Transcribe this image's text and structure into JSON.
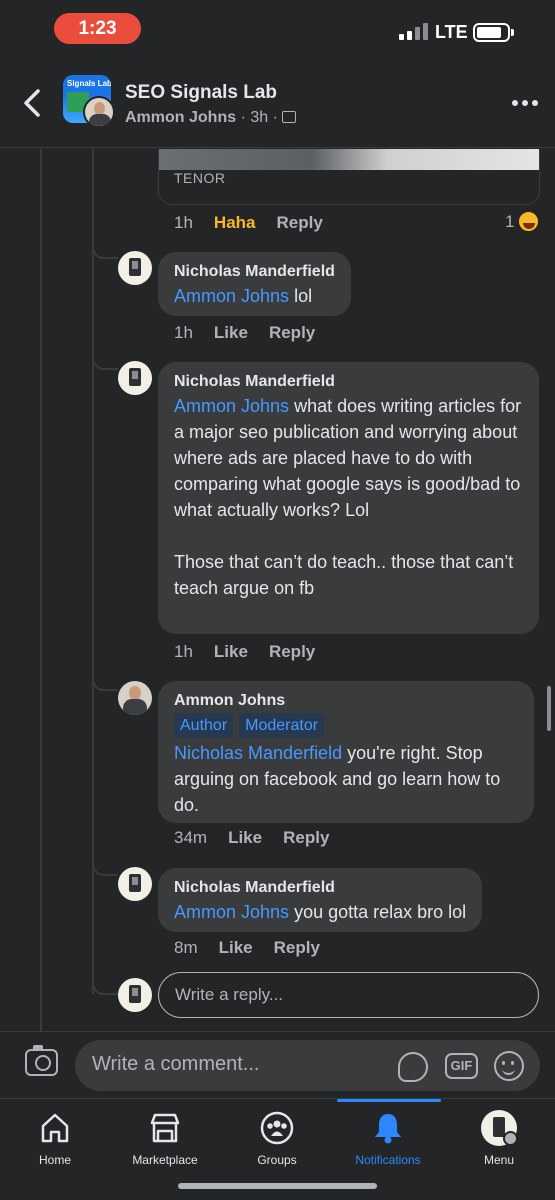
{
  "status_bar": {
    "time": "1:23",
    "network": "LTE"
  },
  "header": {
    "group_name": "SEO Signals Lab",
    "group_avatar_text": "Signals Lab",
    "author": "Ammon Johns",
    "time": "3h",
    "separator": "·"
  },
  "thread": {
    "gif_source": "TENOR",
    "gif_actions": {
      "time": "1h",
      "reaction": "Haha",
      "reply": "Reply",
      "reaction_count": "1"
    },
    "comments": [
      {
        "name": "Nicholas Manderfield",
        "mention": "Ammon Johns",
        "text": " lol",
        "time": "1h",
        "like": "Like",
        "reply": "Reply"
      },
      {
        "name": "Nicholas Manderfield",
        "mention": "Ammon Johns",
        "text": " what does writing articles for a major seo publication and worrying about where ads are placed have to do with comparing what google says is good/bad to what actually works? Lol",
        "text2": "Those that can’t do teach.. those that can’t teach argue on fb",
        "time": "1h",
        "like": "Like",
        "reply": "Reply"
      },
      {
        "name": "Ammon Johns",
        "badges": [
          "Author",
          "Moderator"
        ],
        "mention": "Nicholas Manderfield",
        "text": " you're right. Stop arguing on facebook and go learn how to do.",
        "time": "34m",
        "like": "Like",
        "reply": "Reply"
      },
      {
        "name": "Nicholas Manderfield",
        "mention": "Ammon Johns",
        "text": " you gotta relax bro lol",
        "time": "8m",
        "like": "Like",
        "reply": "Reply"
      }
    ],
    "reply_placeholder": "Write a reply..."
  },
  "composer": {
    "placeholder": "Write a comment...",
    "gif_label": "GIF"
  },
  "tabs": [
    "Home",
    "Marketplace",
    "Groups",
    "Notifications",
    "Menu"
  ],
  "colors": {
    "background": "#242526",
    "bubble": "#3a3b3c",
    "accent": "#2d88ff",
    "mention": "#4599ff",
    "haha": "#f7b928",
    "time_pill": "#eb4d3d"
  }
}
